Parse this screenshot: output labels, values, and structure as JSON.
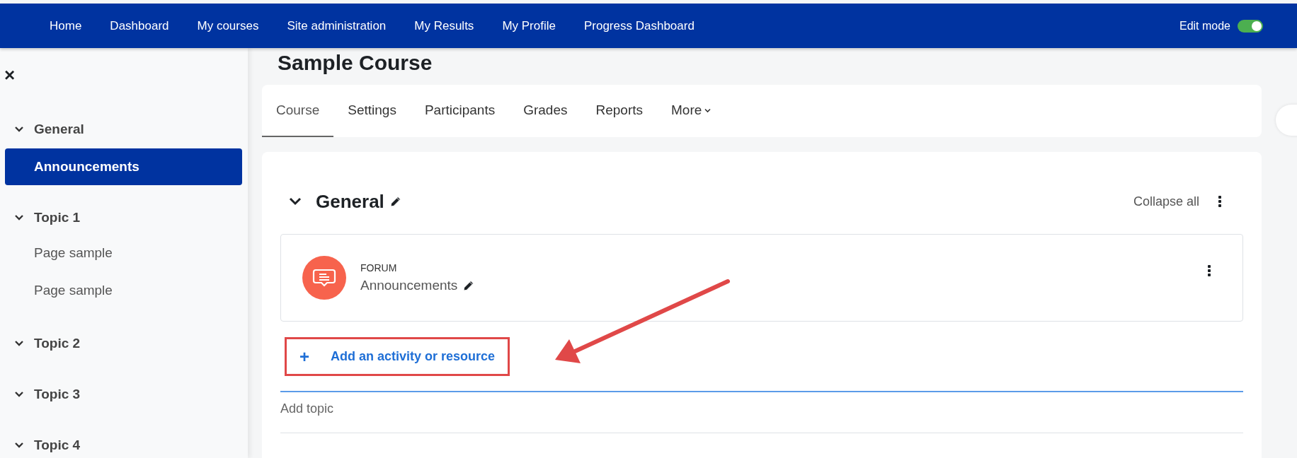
{
  "navbar": {
    "items": [
      {
        "label": "Home"
      },
      {
        "label": "Dashboard"
      },
      {
        "label": "My courses"
      },
      {
        "label": "Site administration"
      },
      {
        "label": "My Results"
      },
      {
        "label": "My Profile"
      },
      {
        "label": "Progress Dashboard"
      }
    ],
    "edit_mode": {
      "label": "Edit mode",
      "on": true
    }
  },
  "sidebar": {
    "close": "×",
    "sections": [
      {
        "title": "General",
        "expanded": true,
        "children": [
          {
            "label": "Announcements",
            "selected": true
          }
        ]
      },
      {
        "title": "Topic 1",
        "expanded": true,
        "children": [
          {
            "label": "Page sample",
            "selected": false
          },
          {
            "label": "Page sample",
            "selected": false
          }
        ]
      },
      {
        "title": "Topic 2",
        "expanded": true
      },
      {
        "title": "Topic 3",
        "expanded": true
      },
      {
        "title": "Topic 4",
        "expanded": true
      }
    ]
  },
  "course": {
    "title": "Sample Course",
    "tabs": [
      {
        "label": "Course",
        "selected": true,
        "kind": "tab"
      },
      {
        "label": "Settings",
        "selected": false,
        "kind": "tab"
      },
      {
        "label": "Participants",
        "selected": false,
        "kind": "tab"
      },
      {
        "label": "Grades",
        "selected": false,
        "kind": "tab"
      },
      {
        "label": "Reports",
        "selected": false,
        "kind": "tab"
      },
      {
        "label": "More",
        "selected": false,
        "kind": "dropdown"
      }
    ],
    "section": {
      "title": "General",
      "expanded": true,
      "collapse_all": "Collapse all",
      "activities": [
        {
          "type": "FORUM",
          "name": "Announcements"
        }
      ],
      "add_activity": "Add an activity or resource",
      "add_activity_icon": "+"
    },
    "add_topic": "Add topic"
  }
}
